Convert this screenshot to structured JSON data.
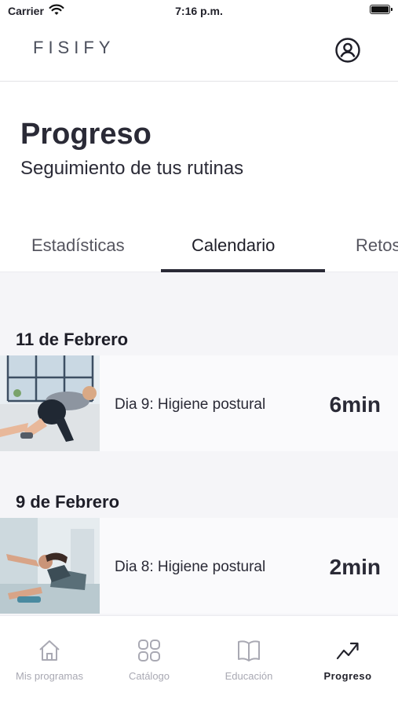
{
  "status": {
    "carrier": "Carrier",
    "time": "7:16 p.m."
  },
  "header": {
    "logo": "FISIFY",
    "profile_icon": "user-circle-icon"
  },
  "page": {
    "title": "Progreso",
    "subtitle": "Seguimiento de tus rutinas"
  },
  "tabs": [
    {
      "label": "Estadísticas",
      "active": false
    },
    {
      "label": "Calendario",
      "active": true
    },
    {
      "label": "Retos",
      "active": false
    }
  ],
  "days": [
    {
      "date": "11 de Febrero",
      "session": {
        "name": "Dia 9: Higiene postural",
        "duration": "6min",
        "thumbnail": "exercise-photo"
      }
    },
    {
      "date": "9 de Febrero",
      "session": {
        "name": "Dia 8: Higiene postural",
        "duration": "2min",
        "thumbnail": "exercise-photo"
      }
    }
  ],
  "tab_bar": [
    {
      "label": "Mis programas",
      "icon": "home-icon",
      "active": false
    },
    {
      "label": "Catálogo",
      "icon": "grid-icon",
      "active": false
    },
    {
      "label": "Educación",
      "icon": "book-icon",
      "active": false
    },
    {
      "label": "Progreso",
      "icon": "trending-up-icon",
      "active": true
    }
  ],
  "colors": {
    "text": "#2a2a36",
    "muted": "#a9a9b3",
    "content_bg": "#f5f5f8"
  }
}
